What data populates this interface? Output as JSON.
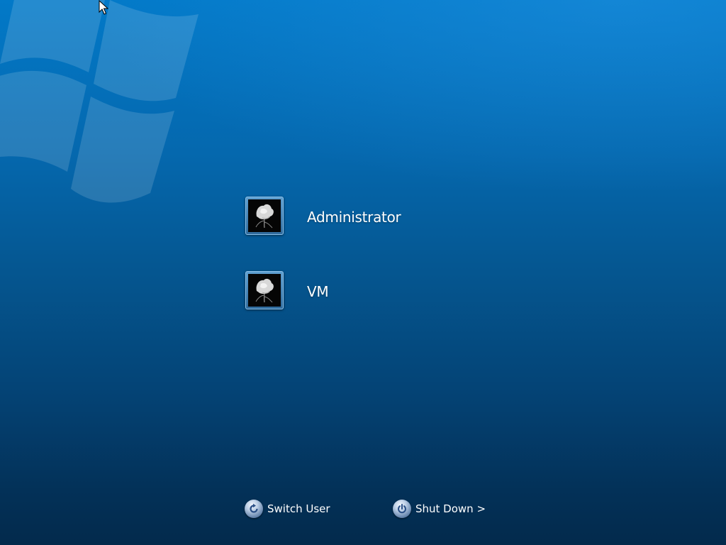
{
  "screen": {
    "name": "Windows logon screen",
    "background_color_top": "#0279c8",
    "background_color_bottom": "#032a4c"
  },
  "users": [
    {
      "name": "Administrator",
      "avatar_icon": "flower-picture-icon"
    },
    {
      "name": "VM",
      "avatar_icon": "flower-picture-icon"
    }
  ],
  "bottom_bar": {
    "switch_user": {
      "label": "Switch User",
      "icon": "switch-user-arrow-icon"
    },
    "shut_down": {
      "label": "Shut Down >",
      "icon": "power-icon"
    }
  }
}
